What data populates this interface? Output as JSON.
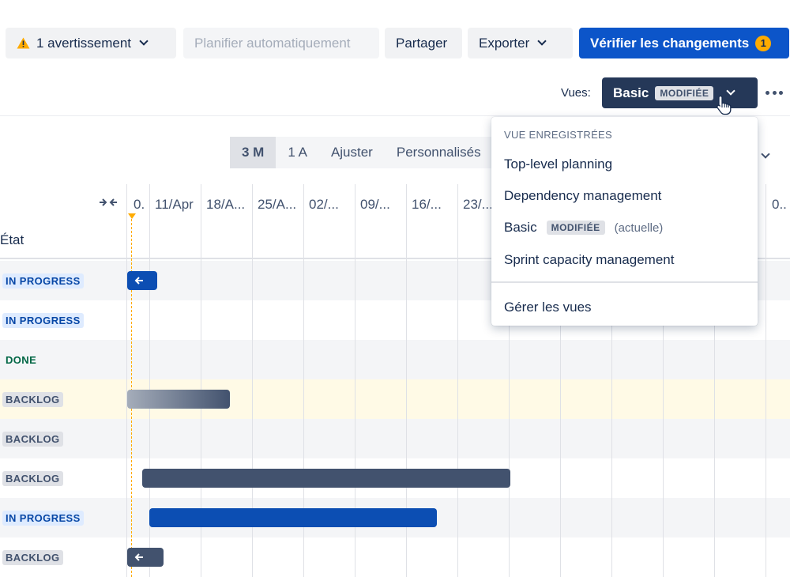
{
  "toolbar": {
    "warning_label": "1 avertissement",
    "auto_schedule_label": "Planifier automatiquement",
    "share_label": "Partager",
    "export_label": "Exporter",
    "review_label": "Vérifier les changements",
    "review_count": "1"
  },
  "views": {
    "label": "Vues:",
    "current_view": "Basic",
    "modified_badge": "MODIFIÉE"
  },
  "zoom": {
    "options": [
      "3 M",
      "1 A",
      "Ajuster",
      "Personnalisés"
    ],
    "selected": "3 M"
  },
  "timeline": {
    "state_header": "État",
    "dates": [
      "0.",
      "11/Apr",
      "18/A...",
      "25/A...",
      "02/...",
      "09/...",
      "16/...",
      "23/...",
      "0.."
    ],
    "rows": [
      {
        "status": "IN PROGRESS"
      },
      {
        "status": "IN PROGRESS"
      },
      {
        "status": "DONE"
      },
      {
        "status": "BACKLOG"
      },
      {
        "status": "BACKLOG"
      },
      {
        "status": "BACKLOG"
      },
      {
        "status": "IN PROGRESS"
      },
      {
        "status": "BACKLOG"
      }
    ]
  },
  "dropdown": {
    "heading": "VUE ENREGISTRÉES",
    "items": [
      "Top-level planning",
      "Dependency management",
      "Basic",
      "Sprint capacity management"
    ],
    "basic_badge": "MODIFIÉE",
    "basic_current": "(actuelle)",
    "manage_label": "Gérer les vues"
  },
  "colors": {
    "primary": "#0c55c9",
    "views_button": "#253858",
    "warning": "#ffab00",
    "bar_blue": "#0c4eb3",
    "bar_navy": "#42526e",
    "in_progress_text": "#0747a6",
    "done_text": "#006644"
  },
  "icons": [
    "warning-icon",
    "chevron-down-icon",
    "more-icon",
    "pointer-cursor-icon",
    "collapse-icon",
    "arrow-left-icon"
  ]
}
